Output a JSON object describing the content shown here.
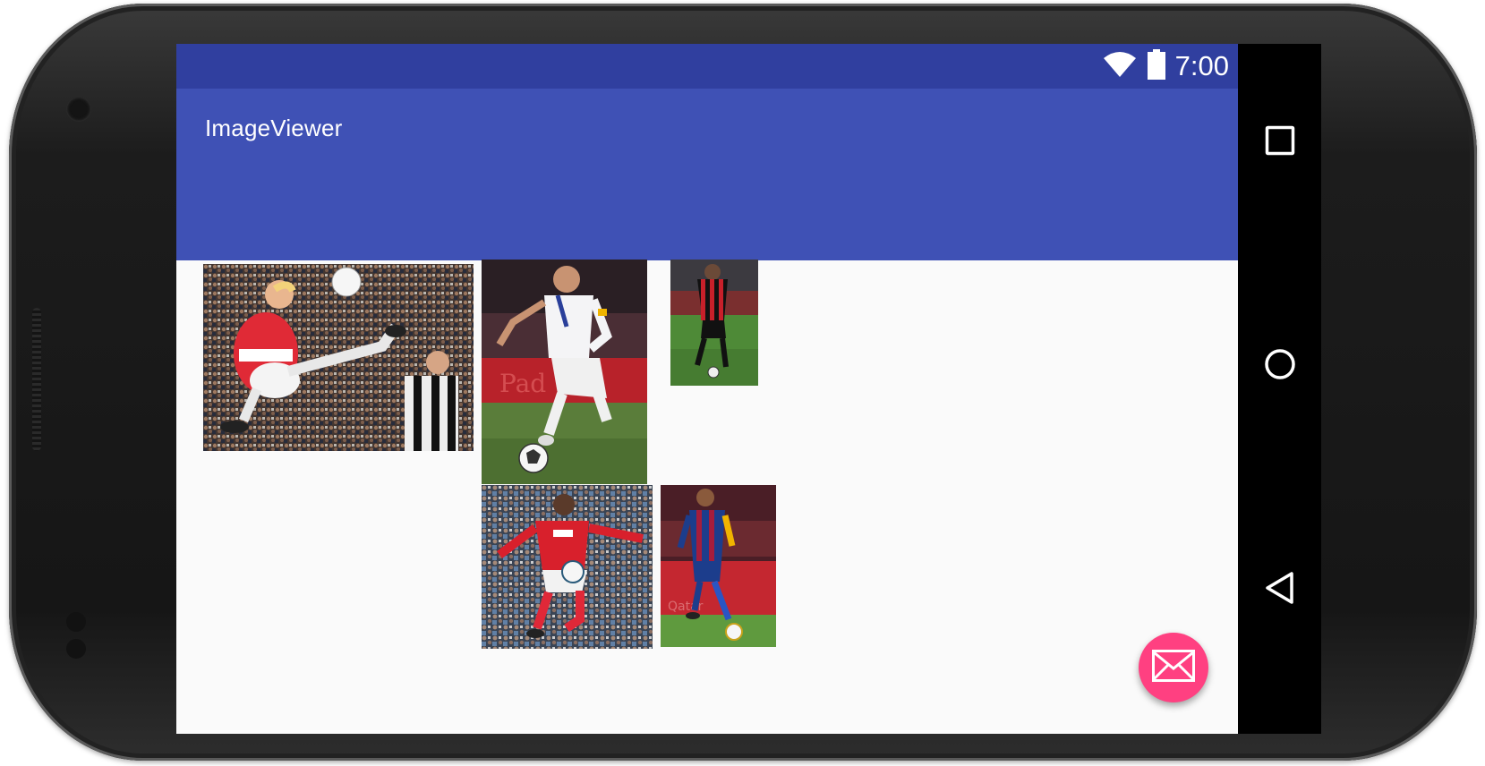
{
  "status_bar": {
    "time": "7:00",
    "icons": [
      "wifi-icon",
      "battery-icon"
    ],
    "color": "#303f9f"
  },
  "app_bar": {
    "title": "ImageViewer",
    "color": "#3f51b5"
  },
  "gallery": {
    "photos": [
      {
        "name": "photo-arsenal-volley",
        "kit": "red-white"
      },
      {
        "name": "photo-france-dribble",
        "kit": "white"
      },
      {
        "name": "photo-milan-striker",
        "kit": "red-black"
      },
      {
        "name": "photo-arsenal-control",
        "kit": "red-white"
      },
      {
        "name": "photo-barcelona-forward",
        "kit": "blue-claret"
      }
    ]
  },
  "fab": {
    "icon": "mail-icon",
    "color": "#ff4081"
  },
  "nav_bar": {
    "buttons": [
      "recents-icon",
      "home-icon",
      "back-icon"
    ]
  }
}
